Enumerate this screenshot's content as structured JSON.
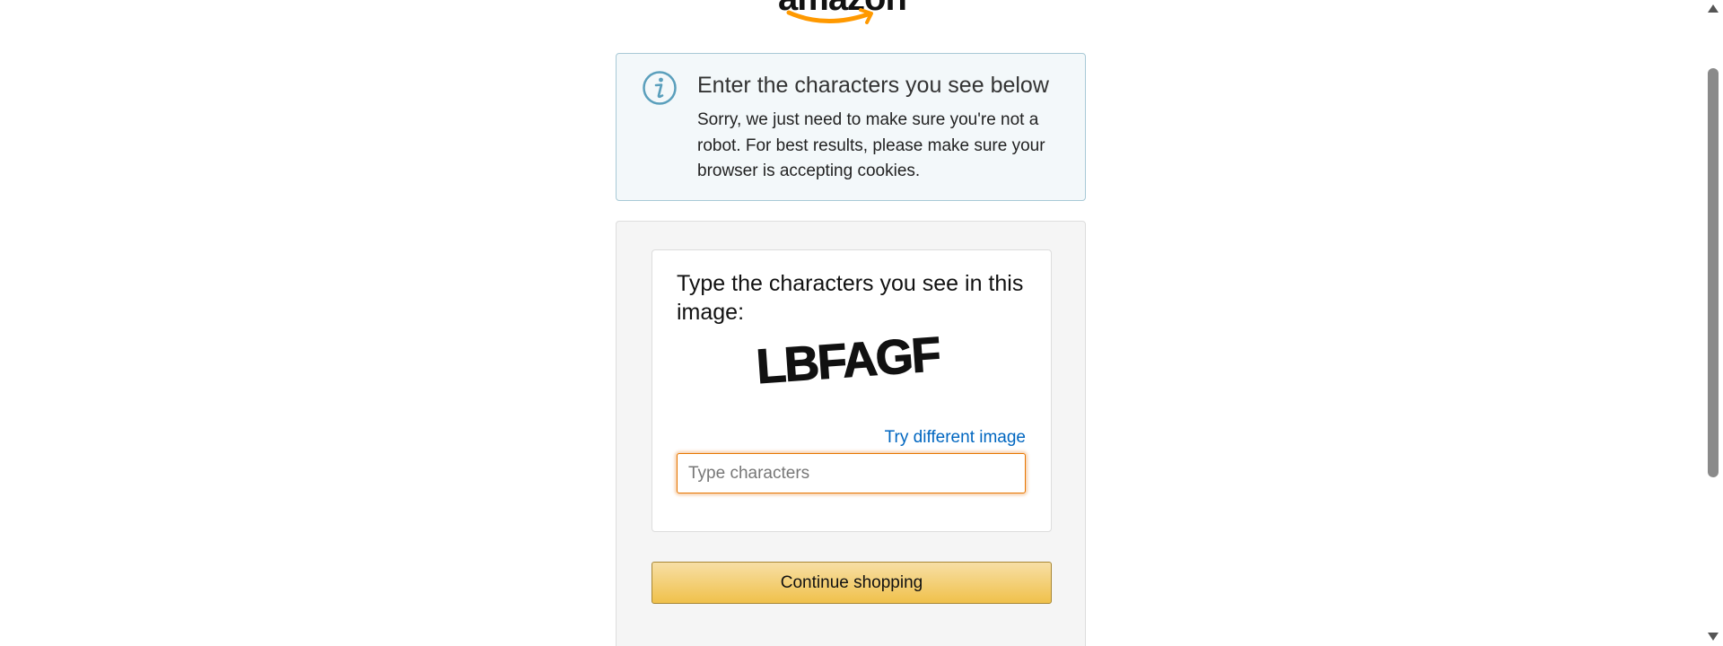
{
  "logo": {
    "text": "amazon",
    "icon": "amazon-smile-logo"
  },
  "alert": {
    "icon": "info-icon",
    "heading": "Enter the characters you see below",
    "body": "Sorry, we just need to make sure you're not a robot. For best results, please make sure your browser is accepting cookies."
  },
  "captcha": {
    "title": "Type the characters you see in this image:",
    "image_text": "LBFAGF",
    "try_link": "Try different image",
    "input_placeholder": "Type characters",
    "input_value": ""
  },
  "continue_button": {
    "label": "Continue shopping"
  },
  "colors": {
    "alert_bg": "#f3f8fa",
    "alert_border": "#a8c9d6",
    "link": "#0066c0",
    "input_focus": "#e77600",
    "button_top": "#f7dfa5",
    "button_bottom": "#f0c14b",
    "logo_orange": "#ff9900"
  },
  "scrollbar": {
    "icons": [
      "scroll-up-icon",
      "scroll-down-icon"
    ]
  }
}
